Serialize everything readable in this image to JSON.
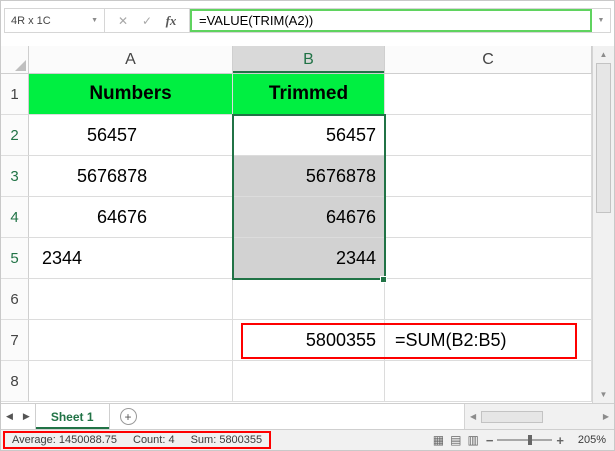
{
  "colors": {
    "excel_green": "#217346",
    "bright_green_fill": "#00ef41",
    "formula_border_green": "#5fd35f",
    "selection_fill_gray": "#d2d2d2",
    "highlight_red": "#fe0000"
  },
  "formula_bar": {
    "name_box_value": "4R x 1C",
    "cancel_icon": "✕",
    "enter_icon": "✓",
    "fx_icon": "fx",
    "formula_value": "=VALUE(TRIM(A2))"
  },
  "grid": {
    "column_headers": [
      "A",
      "B",
      "C"
    ],
    "row_headers": [
      "1",
      "2",
      "3",
      "4",
      "5",
      "6",
      "7",
      "8"
    ],
    "cells": {
      "A1": "Numbers",
      "B1": "Trimmed",
      "A2": "           56457",
      "B2": "56457",
      "A3": "         5676878",
      "B3": "5676878",
      "A4": "             64676",
      "B4": "64676",
      "A5": "  2344",
      "B5": "2344",
      "B7": "5800355",
      "C7": "=SUM(B2:B5)"
    }
  },
  "sheet_bar": {
    "active_tab": "Sheet 1"
  },
  "status_bar": {
    "average": "Average: 1450088.75",
    "count": "Count: 4",
    "sum": "Sum: 5800355",
    "zoom_level": "205%"
  },
  "icons": {
    "dropdown": "▼",
    "scroll_up": "▲",
    "scroll_down": "▼",
    "scroll_left": "◀",
    "scroll_right": "▶",
    "tab_nav_left": "◀",
    "tab_nav_right": "▶",
    "add_sheet": "+",
    "view_normal": "▦",
    "view_page_layout": "▤",
    "view_page_break": "▥",
    "zoom_out": "−",
    "zoom_in": "+"
  }
}
